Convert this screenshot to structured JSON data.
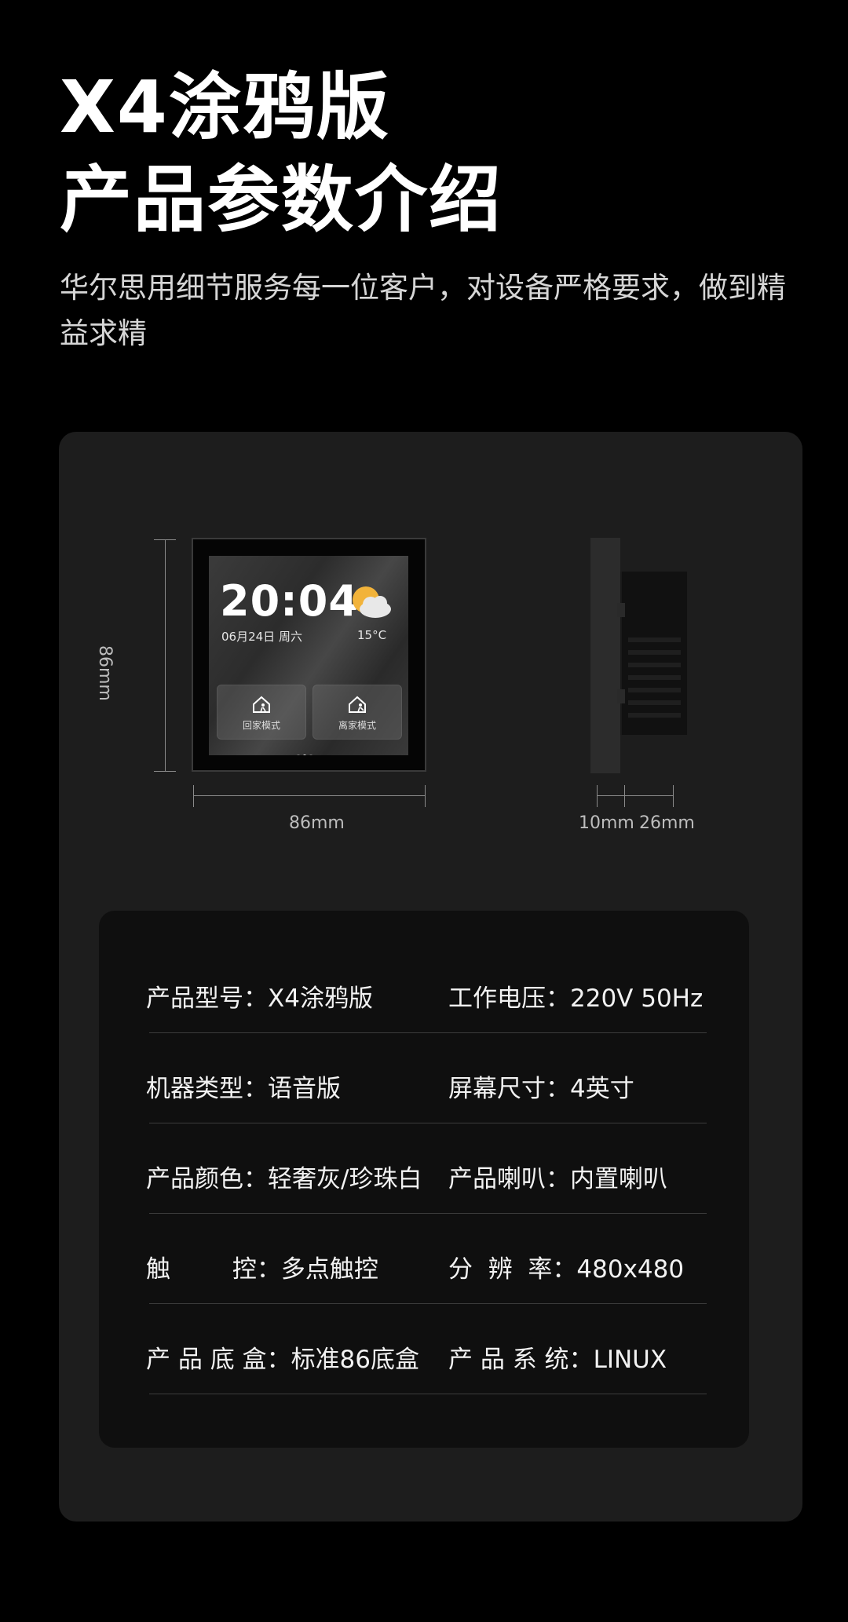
{
  "header": {
    "title_line1": "X4涂鸦版",
    "title_line2": "产品参数介绍",
    "subtitle": "华尔思用细节服务每一位客户，对设备严格要求，做到精益求精"
  },
  "diagram": {
    "height_label": "86mm",
    "width_label": "86mm",
    "depth_label_1": "10mm",
    "depth_label_2": "26mm",
    "screen": {
      "time": "20:04",
      "date": "06月24日  周六",
      "temperature": "15°C",
      "weather_icon": "partly-cloudy-icon",
      "mode_home": "回家模式",
      "mode_away": "离家模式"
    }
  },
  "specs": [
    {
      "left_label": "产品型号：",
      "left_value": "X4涂鸦版",
      "right_label": "工作电压：",
      "right_value": "220V  50Hz"
    },
    {
      "left_label": "机器类型：",
      "left_value": "语音版",
      "right_label": "屏幕尺寸：",
      "right_value": "4英寸"
    },
    {
      "left_label": "产品颜色：",
      "left_value": "轻奢灰/珍珠白",
      "right_label": "产品喇叭：",
      "right_value": "内置喇叭"
    },
    {
      "left_label": "触        控：",
      "left_value": "多点触控",
      "right_label": "分  辨  率：",
      "right_value": "480x480"
    },
    {
      "left_label": "产 品 底 盒：",
      "left_value": "标准86底盒",
      "right_label": "产 品 系 统：",
      "right_value": "LINUX"
    }
  ]
}
